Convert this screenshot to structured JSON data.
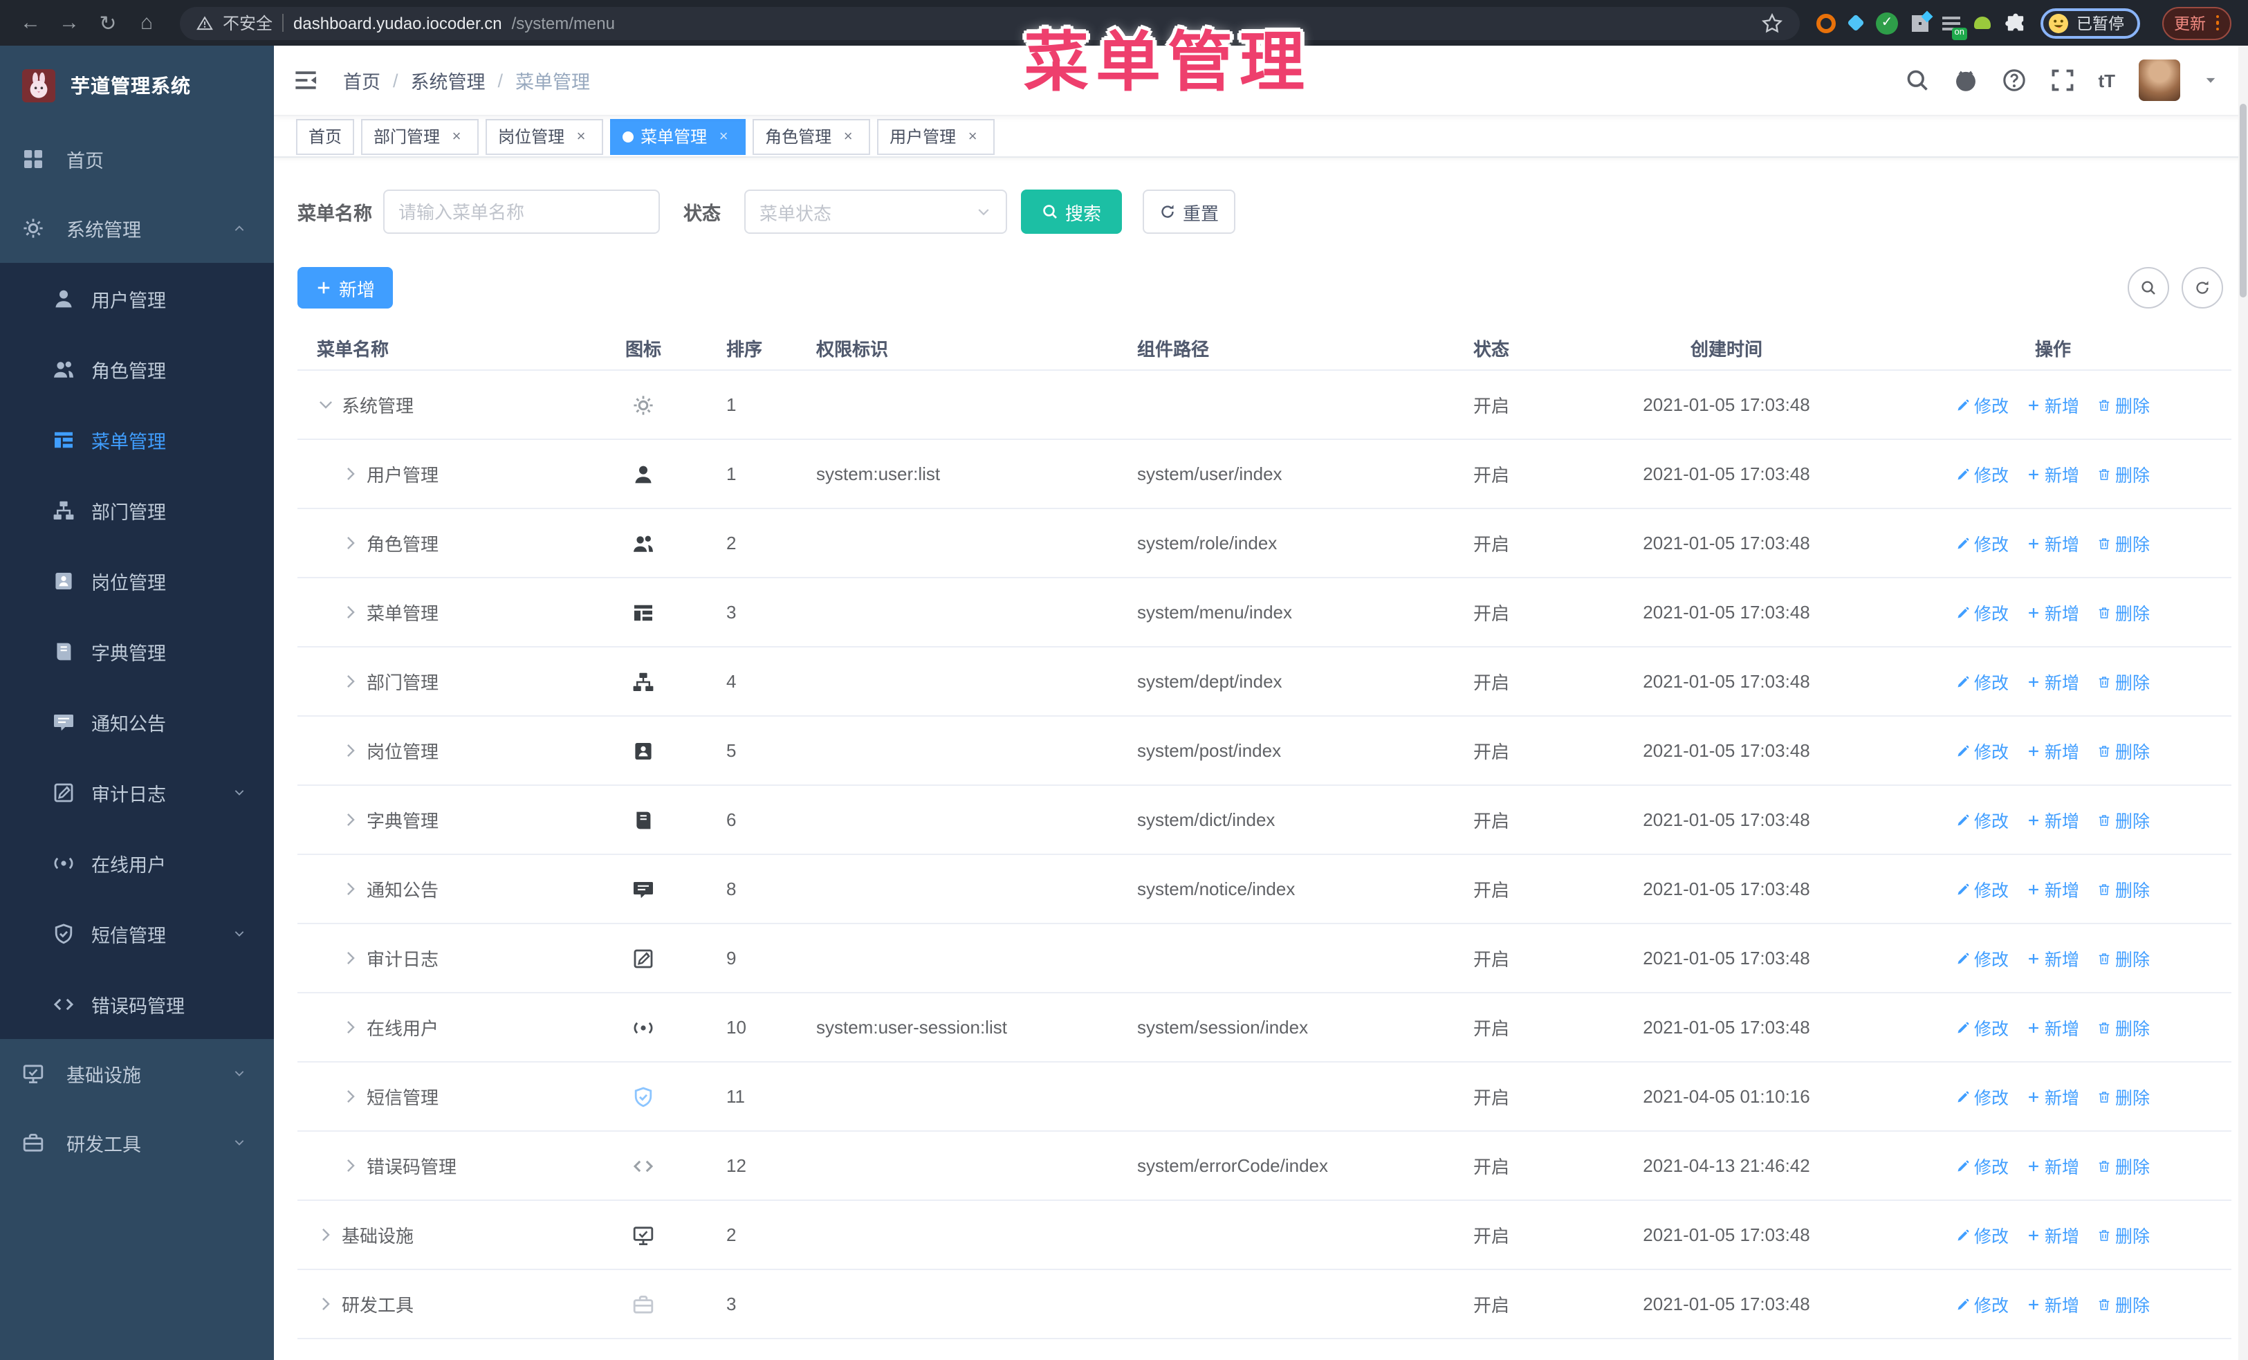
{
  "overlay": {
    "title": "菜单管理"
  },
  "colors": {
    "accent_blue": "#409eff",
    "search_teal": "#1cbfa4",
    "overlay_pink": "#ee3f6d",
    "sidebar_bg": "#2f4961",
    "submenu_bg": "#1e2d45",
    "chrome_bg": "#21262e",
    "paused_border": "#8ab4f8",
    "update_text": "#f28b82"
  },
  "browser": {
    "security_warning": "不安全",
    "url_host": "dashboard.yudao.iocoder.cn",
    "url_path": "/system/menu",
    "paused_badge": "已暂停",
    "update_button": "更新"
  },
  "sidebar": {
    "app_title": "芋道管理系统",
    "items": [
      {
        "label": "首页",
        "icon": "dashboard",
        "level": 0
      },
      {
        "label": "系统管理",
        "icon": "gear",
        "level": 0,
        "arrow": "up"
      },
      {
        "label": "用户管理",
        "icon": "user",
        "level": 1
      },
      {
        "label": "角色管理",
        "icon": "users",
        "level": 1
      },
      {
        "label": "菜单管理",
        "icon": "menu",
        "level": 1,
        "active": true
      },
      {
        "label": "部门管理",
        "icon": "tree",
        "level": 1
      },
      {
        "label": "岗位管理",
        "icon": "badge",
        "level": 1
      },
      {
        "label": "字典管理",
        "icon": "dict",
        "level": 1
      },
      {
        "label": "通知公告",
        "icon": "message",
        "level": 1
      },
      {
        "label": "审计日志",
        "icon": "log",
        "level": 1,
        "arrow": "down"
      },
      {
        "label": "在线用户",
        "icon": "online",
        "level": 1
      },
      {
        "label": "短信管理",
        "icon": "sms",
        "level": 1,
        "arrow": "down"
      },
      {
        "label": "错误码管理",
        "icon": "code",
        "level": 1
      },
      {
        "label": "基础设施",
        "icon": "monitor",
        "level": 0,
        "arrow": "down"
      },
      {
        "label": "研发工具",
        "icon": "tool",
        "level": 0,
        "arrow": "down"
      }
    ]
  },
  "header": {
    "breadcrumb": [
      "首页",
      "系统管理",
      "菜单管理"
    ]
  },
  "tabs": [
    {
      "label": "首页",
      "closable": false,
      "active": false
    },
    {
      "label": "部门管理",
      "closable": true,
      "active": false
    },
    {
      "label": "岗位管理",
      "closable": true,
      "active": false
    },
    {
      "label": "菜单管理",
      "closable": true,
      "active": true
    },
    {
      "label": "角色管理",
      "closable": true,
      "active": false
    },
    {
      "label": "用户管理",
      "closable": true,
      "active": false
    }
  ],
  "filters": {
    "name_label": "菜单名称",
    "name_placeholder": "请输入菜单名称",
    "status_label": "状态",
    "status_placeholder": "菜单状态",
    "search_button": "搜索",
    "reset_button": "重置"
  },
  "toolbar": {
    "add_button": "新增"
  },
  "table": {
    "columns": [
      "菜单名称",
      "图标",
      "排序",
      "权限标识",
      "组件路径",
      "状态",
      "创建时间",
      "操作"
    ],
    "row_actions": [
      "修改",
      "新增",
      "删除"
    ],
    "rows": [
      {
        "name": "系统管理",
        "caret": "down",
        "level": 0,
        "icon": "gear",
        "icon_color": "#9aa0a6",
        "sort": "1",
        "permission": "",
        "path": "",
        "status": "开启",
        "created": "2021-01-05 17:03:48"
      },
      {
        "name": "用户管理",
        "caret": "right",
        "level": 1,
        "icon": "user",
        "icon_color": "#3b4045",
        "sort": "1",
        "permission": "system:user:list",
        "path": "system/user/index",
        "status": "开启",
        "created": "2021-01-05 17:03:48"
      },
      {
        "name": "角色管理",
        "caret": "right",
        "level": 1,
        "icon": "users",
        "icon_color": "#3b4045",
        "sort": "2",
        "permission": "",
        "path": "system/role/index",
        "status": "开启",
        "created": "2021-01-05 17:03:48"
      },
      {
        "name": "菜单管理",
        "caret": "right",
        "level": 1,
        "icon": "menu",
        "icon_color": "#3b4045",
        "sort": "3",
        "permission": "",
        "path": "system/menu/index",
        "status": "开启",
        "created": "2021-01-05 17:03:48"
      },
      {
        "name": "部门管理",
        "caret": "right",
        "level": 1,
        "icon": "tree",
        "icon_color": "#3b4045",
        "sort": "4",
        "permission": "",
        "path": "system/dept/index",
        "status": "开启",
        "created": "2021-01-05 17:03:48"
      },
      {
        "name": "岗位管理",
        "caret": "right",
        "level": 1,
        "icon": "badge",
        "icon_color": "#3b4045",
        "sort": "5",
        "permission": "",
        "path": "system/post/index",
        "status": "开启",
        "created": "2021-01-05 17:03:48"
      },
      {
        "name": "字典管理",
        "caret": "right",
        "level": 1,
        "icon": "dict",
        "icon_color": "#3b4045",
        "sort": "6",
        "permission": "",
        "path": "system/dict/index",
        "status": "开启",
        "created": "2021-01-05 17:03:48"
      },
      {
        "name": "通知公告",
        "caret": "right",
        "level": 1,
        "icon": "message",
        "icon_color": "#3b4045",
        "sort": "8",
        "permission": "",
        "path": "system/notice/index",
        "status": "开启",
        "created": "2021-01-05 17:03:48"
      },
      {
        "name": "审计日志",
        "caret": "right",
        "level": 1,
        "icon": "log",
        "icon_color": "#4a4f55",
        "sort": "9",
        "permission": "",
        "path": "",
        "status": "开启",
        "created": "2021-01-05 17:03:48"
      },
      {
        "name": "在线用户",
        "caret": "right",
        "level": 1,
        "icon": "online",
        "icon_color": "#4a4f55",
        "sort": "10",
        "permission": "system:user-session:list",
        "path": "system/session/index",
        "status": "开启",
        "created": "2021-01-05 17:03:48"
      },
      {
        "name": "短信管理",
        "caret": "right",
        "level": 1,
        "icon": "sms",
        "icon_color": "#8cc5ff",
        "sort": "11",
        "permission": "",
        "path": "",
        "status": "开启",
        "created": "2021-04-05 01:10:16"
      },
      {
        "name": "错误码管理",
        "caret": "right",
        "level": 1,
        "icon": "code",
        "icon_color": "#9aa0a6",
        "sort": "12",
        "permission": "",
        "path": "system/errorCode/index",
        "status": "开启",
        "created": "2021-04-13 21:46:42"
      },
      {
        "name": "基础设施",
        "caret": "right",
        "level": 0,
        "icon": "monitor",
        "icon_color": "#4a4f55",
        "sort": "2",
        "permission": "",
        "path": "",
        "status": "开启",
        "created": "2021-01-05 17:03:48"
      },
      {
        "name": "研发工具",
        "caret": "right",
        "level": 0,
        "icon": "tool",
        "icon_color": "#c4c9d1",
        "sort": "3",
        "permission": "",
        "path": "",
        "status": "开启",
        "created": "2021-01-05 17:03:48"
      }
    ]
  }
}
